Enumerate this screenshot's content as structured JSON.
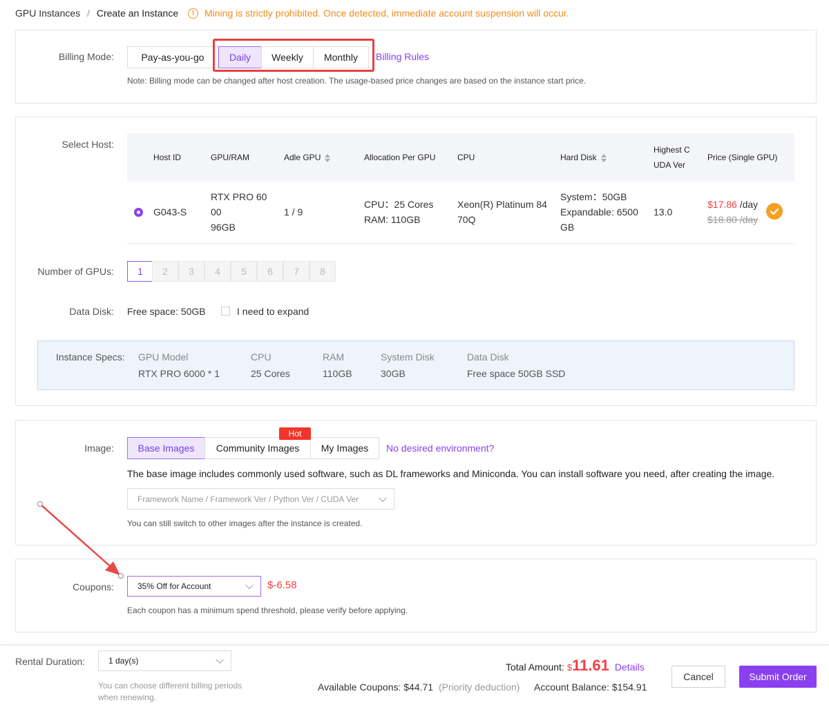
{
  "breadcrumb": {
    "parent": "GPU Instances",
    "separator": "/",
    "current": "Create an Instance"
  },
  "warning": {
    "icon": "warning-icon",
    "text": "Mining is strictly prohibited. Once detected, immediate account suspension will occur."
  },
  "billing": {
    "label": "Billing Mode:",
    "modes": [
      "Pay-as-you-go",
      "Daily",
      "Weekly",
      "Monthly"
    ],
    "selected": "Daily",
    "rules_link": "Billing Rules",
    "note": "Note: Billing mode can be changed after host creation. The usage-based price changes are based on the instance start price."
  },
  "host": {
    "label": "Select Host:",
    "columns": [
      "Host ID",
      "GPU/RAM",
      "Adle GPU",
      "Allocation Per GPU",
      "CPU",
      "Hard Disk",
      "Highest C",
      "UDA Ver",
      "Price (Single GPU)"
    ],
    "row": {
      "host_id": "G043-S",
      "gpu_line1": "RTX PRO 60",
      "gpu_line2": "00",
      "gpu_line3": "96GB",
      "idle_gpu": "1 / 9",
      "alloc_cpu": "CPU：25 Cores",
      "alloc_ram": "RAM: 110GB",
      "cpu_line1": "Xeon(R) Platinum 84",
      "cpu_line2": "70Q",
      "disk_line1": "System：50GB",
      "disk_line2": "Expandable: 6500",
      "disk_line3": "GB",
      "cuda": "13.0",
      "price": "$17.86",
      "price_unit": " /day",
      "old_price": "$18.80 /day"
    }
  },
  "gpus": {
    "label": "Number of GPUs:",
    "options": [
      "1",
      "2",
      "3",
      "4",
      "5",
      "6",
      "7",
      "8"
    ],
    "selected": "1"
  },
  "data_disk": {
    "label": "Data Disk:",
    "free": "Free space: 50GB",
    "expand_label": "I need to expand"
  },
  "specs": {
    "label": "Instance Specs:",
    "items": [
      {
        "name": "GPU Model",
        "value": "RTX PRO 6000 * 1"
      },
      {
        "name": "CPU",
        "value": "25 Cores"
      },
      {
        "name": "RAM",
        "value": "110GB"
      },
      {
        "name": "System Disk",
        "value": "30GB"
      },
      {
        "name": "Data Disk",
        "value": "Free space 50GB SSD"
      }
    ]
  },
  "image": {
    "label": "Image:",
    "tabs": [
      "Base Images",
      "Community Images",
      "My Images"
    ],
    "hot_badge": "Hot",
    "link": "No desired environment?",
    "desc": "The base image includes commonly used software, such as DL frameworks and Miniconda. You can install software you need, after creating the image.",
    "select_placeholder": "Framework Name / Framework Ver / Python Ver / CUDA Ver",
    "note": "You can still switch to other images after the instance is created."
  },
  "coupons": {
    "label": "Coupons:",
    "selected": "35% Off for Account",
    "discount": "$-6.58",
    "note": "Each coupon has a minimum spend threshold, please verify before applying."
  },
  "footer": {
    "duration_label": "Rental Duration:",
    "duration_value": "1 day(s)",
    "duration_note1": "You can choose different billing periods",
    "duration_note2": "when renewing.",
    "total_label": "Total Amount:",
    "total_currency": "$",
    "total_value": "11.61",
    "details_link": "Details",
    "available_label": "Available Coupons: $44.71",
    "priority": "(Priority deduction)",
    "balance": "Account Balance: $154.91",
    "cancel": "Cancel",
    "submit": "Submit Order"
  },
  "colors": {
    "accent": "#8a3ff0",
    "danger": "#f04040",
    "warning": "#f08c1a",
    "highlight": "#e84040"
  }
}
